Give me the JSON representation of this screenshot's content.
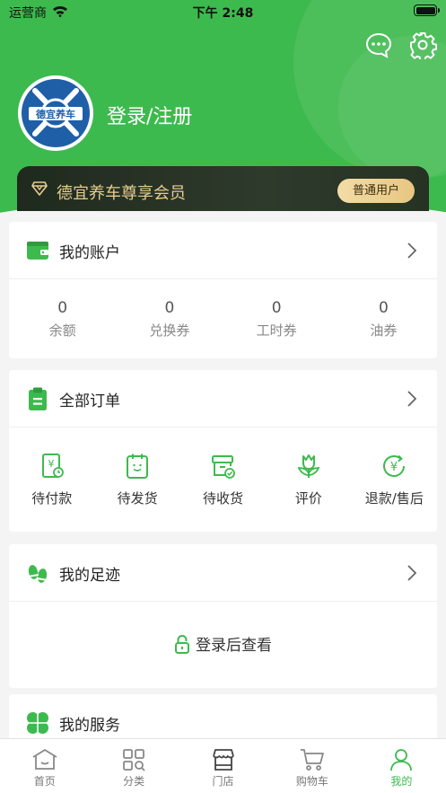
{
  "status_bar": {
    "carrier": "运营商",
    "time": "下午 2:48"
  },
  "header": {
    "avatar_text": "德宜养车",
    "login_label": "登录/注册",
    "vip_title": "德宜养车尊享会员",
    "vip_level": "普通用户"
  },
  "account": {
    "title": "我的账户",
    "stats": [
      {
        "value": "0",
        "label": "余额"
      },
      {
        "value": "0",
        "label": "兑换券"
      },
      {
        "value": "0",
        "label": "工时券"
      },
      {
        "value": "0",
        "label": "油券"
      }
    ]
  },
  "orders": {
    "title": "全部订单",
    "items": [
      {
        "label": "待付款",
        "icon": "pending-payment-icon"
      },
      {
        "label": "待发货",
        "icon": "pending-shipment-icon"
      },
      {
        "label": "待收货",
        "icon": "pending-receipt-icon"
      },
      {
        "label": "评价",
        "icon": "review-icon"
      },
      {
        "label": "退款/售后",
        "icon": "refund-icon"
      }
    ]
  },
  "footprint": {
    "title": "我的足迹",
    "locked_text": "登录后查看"
  },
  "service": {
    "title": "我的服务"
  },
  "tabbar": {
    "items": [
      {
        "label": "首页",
        "icon": "home-icon"
      },
      {
        "label": "分类",
        "icon": "category-icon"
      },
      {
        "label": "门店",
        "icon": "store-icon"
      },
      {
        "label": "购物车",
        "icon": "cart-icon"
      },
      {
        "label": "我的",
        "icon": "profile-icon"
      }
    ],
    "active_index": 4
  },
  "colors": {
    "brand": "#3dba4e",
    "vip_gold": "#e7cc8f",
    "vip_dark": "#1f2a1e"
  }
}
